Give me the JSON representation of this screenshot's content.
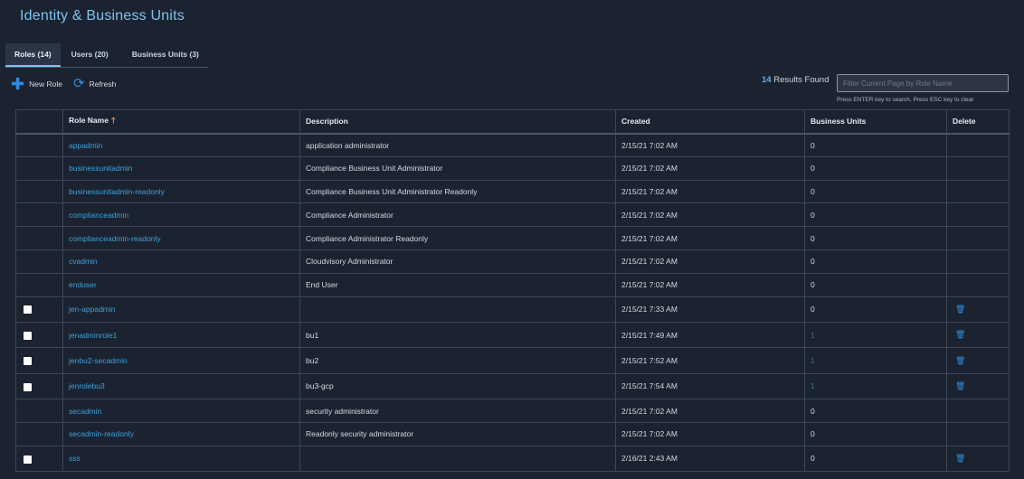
{
  "page": {
    "title": "Identity & Business Units"
  },
  "tabs": [
    {
      "label": "Roles (14)",
      "active": true
    },
    {
      "label": "Users (20)",
      "active": false
    },
    {
      "label": "Business Units (3)",
      "active": false
    }
  ],
  "toolbar": {
    "new_role_label": "New Role",
    "refresh_label": "Refresh"
  },
  "results": {
    "count": "14",
    "suffix": "Results Found"
  },
  "search": {
    "placeholder": "Filter Current Page by Role Name",
    "hint": "Press ENTER key to search, Press ESC key to clear"
  },
  "table": {
    "columns": [
      "",
      "Role Name",
      "Description",
      "Created",
      "Business Units",
      "Delete"
    ],
    "rows": [
      {
        "checkbox": false,
        "name": "appadmin",
        "description": "application administrator",
        "created": "2/15/21 7:02 AM",
        "business_units": "0",
        "deletable": false
      },
      {
        "checkbox": false,
        "name": "businessunitadmin",
        "description": "Compliance Business Unit Administrator",
        "created": "2/15/21 7:02 AM",
        "business_units": "0",
        "deletable": false
      },
      {
        "checkbox": false,
        "name": "businessunitadmin-readonly",
        "description": "Compliance Business Unit Administrator Readonly",
        "created": "2/15/21 7:02 AM",
        "business_units": "0",
        "deletable": false
      },
      {
        "checkbox": false,
        "name": "complianceadmin",
        "description": "Compliance Administrator",
        "created": "2/15/21 7:02 AM",
        "business_units": "0",
        "deletable": false
      },
      {
        "checkbox": false,
        "name": "complianceadmin-readonly",
        "description": "Compliance Administrator Readonly",
        "created": "2/15/21 7:02 AM",
        "business_units": "0",
        "deletable": false
      },
      {
        "checkbox": false,
        "name": "cvadmin",
        "description": "Cloudvisory Administrator",
        "created": "2/15/21 7:02 AM",
        "business_units": "0",
        "deletable": false
      },
      {
        "checkbox": false,
        "name": "enduser",
        "description": "End User",
        "created": "2/15/21 7:02 AM",
        "business_units": "0",
        "deletable": false
      },
      {
        "checkbox": true,
        "name": "jen-appadmin",
        "description": "",
        "created": "2/15/21 7:33 AM",
        "business_units": "0",
        "deletable": true
      },
      {
        "checkbox": true,
        "name": "jenadminrole1",
        "description": "bu1",
        "created": "2/15/21 7:49 AM",
        "business_units": "1",
        "deletable": true
      },
      {
        "checkbox": true,
        "name": "jenbu2-secadmin",
        "description": "bu2",
        "created": "2/15/21 7:52 AM",
        "business_units": "1",
        "deletable": true
      },
      {
        "checkbox": true,
        "name": "jenrolebu3",
        "description": "bu3-gcp",
        "created": "2/15/21 7:54 AM",
        "business_units": "1",
        "deletable": true
      },
      {
        "checkbox": false,
        "name": "secadmin",
        "description": "security administrator",
        "created": "2/15/21 7:02 AM",
        "business_units": "0",
        "deletable": false
      },
      {
        "checkbox": false,
        "name": "secadmin-readonly",
        "description": "Readonly security administrator",
        "created": "2/15/21 7:02 AM",
        "business_units": "0",
        "deletable": false
      },
      {
        "checkbox": true,
        "name": "sss",
        "description": "",
        "created": "2/16/21 2:43 AM",
        "business_units": "0",
        "deletable": true
      }
    ]
  },
  "colors": {
    "background": "#1b2330",
    "title": "#7fc3ee",
    "link": "#3fa0dc",
    "accent": "#2f8ee0",
    "sort_arrow": "#f0a33a"
  },
  "icons": {
    "new_role": "plus-icon",
    "refresh": "refresh-icon",
    "sort": "sort-ascending-icon",
    "delete": "trash-icon"
  }
}
